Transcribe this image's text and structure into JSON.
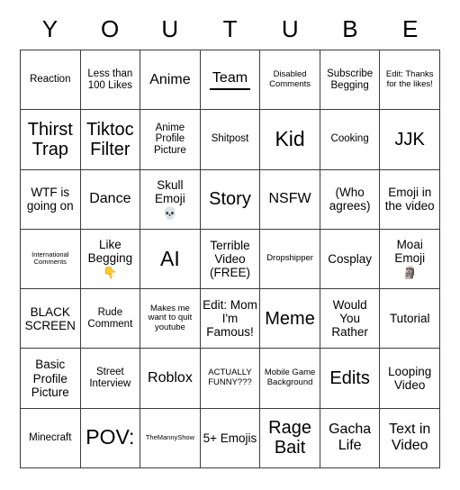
{
  "card": {
    "header_letters": [
      "Y",
      "O",
      "U",
      "T",
      "U",
      "B",
      "E"
    ],
    "rows": [
      [
        {
          "text": "Reaction",
          "size": "fs-s"
        },
        {
          "text": "Less than 100 Likes",
          "size": "fs-s"
        },
        {
          "text": "Anime",
          "size": "fs-l"
        },
        {
          "text": "Team",
          "size": "fs-l",
          "rule": true
        },
        {
          "text": "Disabled Comments",
          "size": "fs-xs"
        },
        {
          "text": "Subscribe Begging",
          "size": "fs-s"
        },
        {
          "text": "Edit: Thanks for the likes!",
          "size": "fs-xs"
        }
      ],
      [
        {
          "text": "Thirst Trap",
          "size": "fs-xl"
        },
        {
          "text": "Tiktoc Filter",
          "size": "fs-xl"
        },
        {
          "text": "Anime Profile Picture",
          "size": "fs-s"
        },
        {
          "text": "Shitpost",
          "size": "fs-s"
        },
        {
          "text": "Kid",
          "size": "fs-xxl"
        },
        {
          "text": "Cooking",
          "size": "fs-s"
        },
        {
          "text": "JJK",
          "size": "fs-xl"
        }
      ],
      [
        {
          "text": "WTF is going on",
          "size": "fs-m"
        },
        {
          "text": "Dance",
          "size": "fs-l"
        },
        {
          "text": "Skull Emoji",
          "size": "fs-m",
          "emoji": "💀"
        },
        {
          "text": "Story",
          "size": "fs-xl"
        },
        {
          "text": "NSFW",
          "size": "fs-l"
        },
        {
          "text": "(Who agrees)",
          "size": "fs-m"
        },
        {
          "text": "Emoji in the video",
          "size": "fs-m"
        }
      ],
      [
        {
          "text": "International Comments",
          "size": "fs-xxs"
        },
        {
          "text": "Like Begging",
          "size": "fs-m",
          "emoji": "👇"
        },
        {
          "text": "AI",
          "size": "fs-xxl"
        },
        {
          "text": "Terrible Video (FREE)",
          "size": "fs-m"
        },
        {
          "text": "Dropshipper",
          "size": "fs-xs"
        },
        {
          "text": "Cosplay",
          "size": "fs-m"
        },
        {
          "text": "Moai Emoji",
          "size": "fs-m",
          "emoji": "🗿"
        }
      ],
      [
        {
          "text": "BLACK SCREEN",
          "size": "fs-m"
        },
        {
          "text": "Rude Comment",
          "size": "fs-s"
        },
        {
          "text": "Makes me want to quit youtube",
          "size": "fs-xs"
        },
        {
          "text": "Edit: Mom I'm Famous!",
          "size": "fs-m"
        },
        {
          "text": "Meme",
          "size": "fs-xl"
        },
        {
          "text": "Would You Rather",
          "size": "fs-m"
        },
        {
          "text": "Tutorial",
          "size": "fs-m"
        }
      ],
      [
        {
          "text": "Basic Profile Picture",
          "size": "fs-m"
        },
        {
          "text": "Street Interview",
          "size": "fs-s"
        },
        {
          "text": "Roblox",
          "size": "fs-l"
        },
        {
          "text": "ACTUALLY FUNNY???",
          "size": "fs-xs"
        },
        {
          "text": "Mobile Game Background",
          "size": "fs-xs"
        },
        {
          "text": "Edits",
          "size": "fs-xl"
        },
        {
          "text": "Looping Video",
          "size": "fs-m"
        }
      ],
      [
        {
          "text": "Minecraft",
          "size": "fs-s"
        },
        {
          "text": "POV:",
          "size": "fs-xxl"
        },
        {
          "text": "TheMannyShow",
          "size": "fs-xxs"
        },
        {
          "text": "5+ Emojis",
          "size": "fs-m"
        },
        {
          "text": "Rage Bait",
          "size": "fs-xl"
        },
        {
          "text": "Gacha Life",
          "size": "fs-l"
        },
        {
          "text": "Text in Video",
          "size": "fs-l"
        }
      ]
    ]
  },
  "colors": {
    "background": "#ffffff",
    "grid_line": "#3c3c3c",
    "text": "#000000"
  }
}
